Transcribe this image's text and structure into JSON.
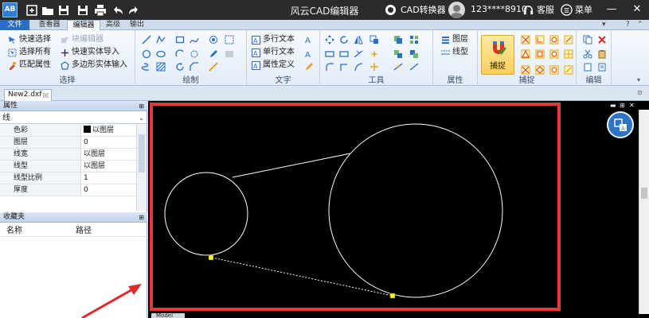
{
  "app": {
    "title": "风云CAD编辑器",
    "icon_text": "AB",
    "converter_label": "CAD转换器",
    "user": "123****8910",
    "service": "客服",
    "menu": "菜单"
  },
  "tabs": [
    {
      "label": "文件"
    },
    {
      "label": "查看器"
    },
    {
      "label": "编辑器"
    },
    {
      "label": "高级"
    },
    {
      "label": "输出"
    }
  ],
  "ribbon": {
    "select": {
      "label": "选择",
      "items": [
        "快速选择",
        "选择所有",
        "匹配属性"
      ],
      "items2": [
        "块编辑器",
        "快速实体导入",
        "多边形实体输入"
      ]
    },
    "draw": {
      "label": "绘制"
    },
    "text": {
      "label": "文字",
      "items": [
        "多行文本",
        "单行文本",
        "属性定义"
      ]
    },
    "tools": {
      "label": "工具"
    },
    "props": {
      "label": "属性",
      "items": [
        "图层",
        "线型"
      ]
    },
    "snap": {
      "label": "捕捉",
      "button": "捕捉"
    },
    "edit": {
      "label": "编辑"
    }
  },
  "document_tab": "New2.dxf",
  "properties_panel": {
    "title": "属性",
    "selector": "线",
    "rows": [
      {
        "key": "色彩",
        "value": "以图层",
        "swatch": true
      },
      {
        "key": "图层",
        "value": "0"
      },
      {
        "key": "线宽",
        "value": "以图层"
      },
      {
        "key": "线型",
        "value": "以图层"
      },
      {
        "key": "线型比例",
        "value": "1"
      },
      {
        "key": "厚度",
        "value": "0"
      }
    ]
  },
  "favorites_panel": {
    "title": "收藏夹",
    "col_name": "名称",
    "col_path": "路径"
  },
  "model_tab": "Model",
  "colors": {
    "highlight_border": "#e23a3a",
    "canvas_bg": "#000000",
    "grip": "#ffff00",
    "file_tab": "#2b6ec7",
    "arrow": "#e02a2a"
  }
}
